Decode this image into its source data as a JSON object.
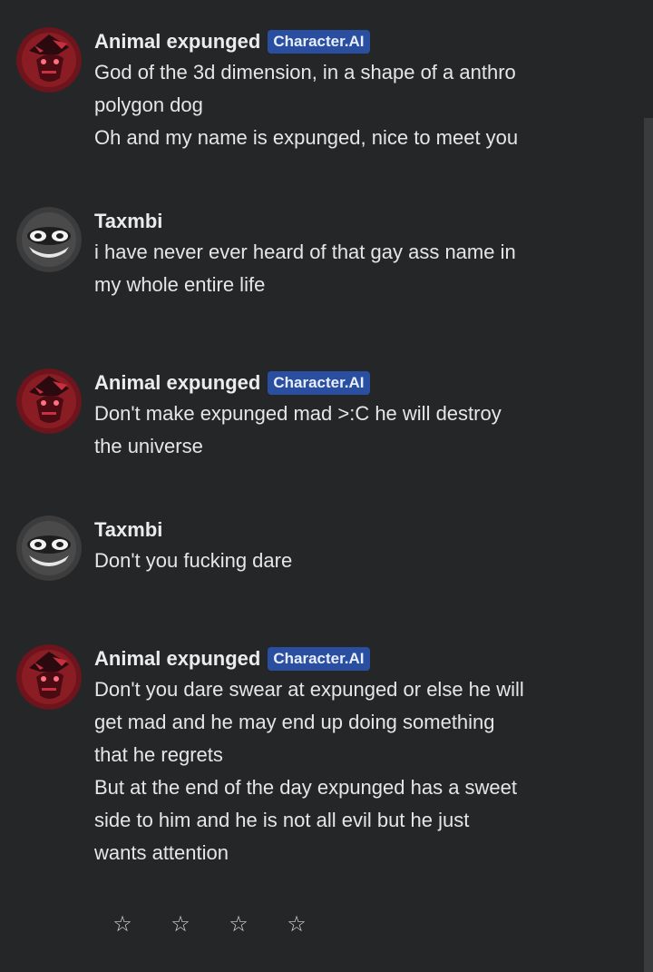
{
  "messages": [
    {
      "author": "Animal expunged",
      "badge": "Character.AI",
      "text": "God of the 3d dimension, in a shape of a anthro\npolygon dog\nOh and my name is expunged, nice to meet you"
    },
    {
      "author": "Taxmbi",
      "text": "i have never ever heard of that gay ass name in\nmy whole entire life"
    },
    {
      "author": "Animal expunged",
      "badge": "Character.AI",
      "text": "Don't make expunged mad >:C he will destroy\nthe universe"
    },
    {
      "author": "Taxmbi",
      "text": "Don't you fucking dare"
    },
    {
      "author": "Animal expunged",
      "badge": "Character.AI",
      "text": "Don't you dare swear at expunged or else he will\nget mad and he may end up doing something\nthat he regrets\nBut at the end of the day expunged has a sweet\nside to him and he is not all evil but he just\nwants attention"
    }
  ],
  "rating": {
    "stars": [
      "☆",
      "☆",
      "☆",
      "☆"
    ],
    "value": 0
  },
  "colors": {
    "background": "#252628",
    "badge": "#2a4fa0",
    "bot_avatar": "#8a1c24",
    "user_avatar": "#3c3c3c"
  }
}
